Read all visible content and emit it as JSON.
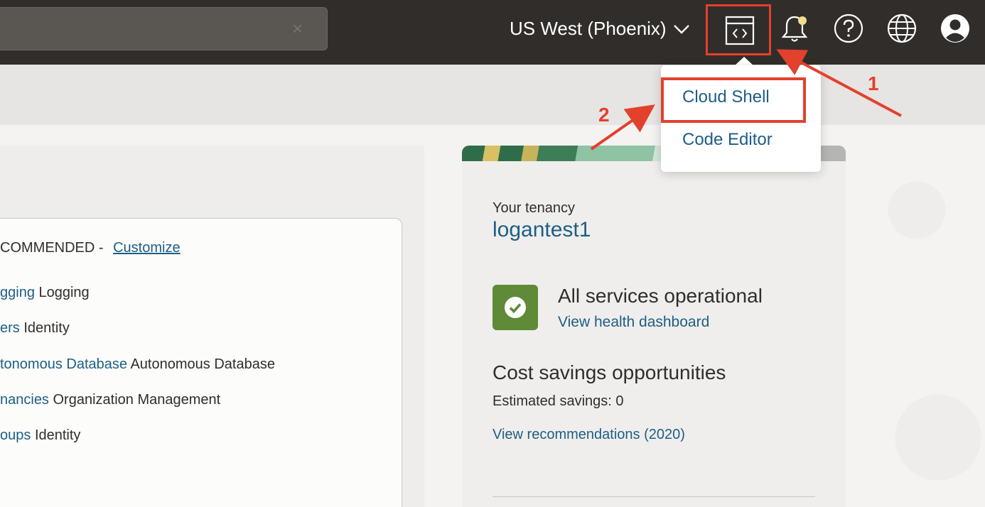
{
  "header": {
    "region_label": "US West (Phoenix)",
    "icons": [
      "chevron-down-icon",
      "developer-tools-icon",
      "bell-icon",
      "help-icon",
      "globe-icon",
      "user-icon"
    ]
  },
  "dropdown": {
    "items": [
      {
        "label": "Cloud Shell"
      },
      {
        "label": "Code Editor"
      }
    ]
  },
  "recommended": {
    "header_text": "COMMENDED -",
    "customize_label": "Customize",
    "items": [
      {
        "link": "gging",
        "service": "Logging"
      },
      {
        "link": "ers",
        "service": "Identity"
      },
      {
        "link": "tonomous Database",
        "service": "Autonomous Database"
      },
      {
        "link": "nancies",
        "service": "Organization Management"
      },
      {
        "link": "oups",
        "service": "Identity"
      }
    ]
  },
  "tenancy": {
    "label": "Your tenancy",
    "name": "logantest1"
  },
  "health": {
    "title": "All services operational",
    "link": "View health dashboard"
  },
  "cost": {
    "title": "Cost savings opportunities",
    "estimated": "Estimated savings: 0",
    "link": "View recommendations (2020)"
  },
  "annotations": {
    "step1": "1",
    "step2": "2",
    "color": "#e2412c"
  },
  "colors": {
    "header_bg": "#312d2a",
    "link": "#1d5e85",
    "success": "#5f8a37"
  }
}
